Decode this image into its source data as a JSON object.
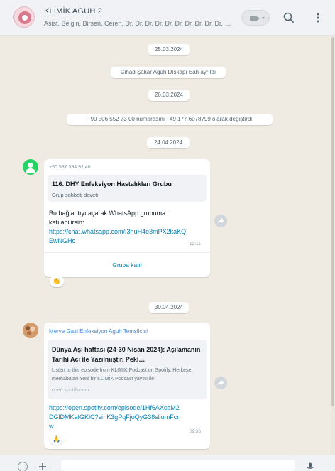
{
  "header": {
    "title": "KLİMİK AGUH 2",
    "members": "Asist. Belgin, Birsen, Ceren, Dr. Dr. Dr. Dr. Dr. Dr. Dr. Dr. Dr. Dr. Dr. ..."
  },
  "icons": {
    "video_call": "video-camera-icon",
    "search": "search-icon",
    "menu": "kebab-menu-icon",
    "forward": "forward-icon",
    "emoji": "smiley-icon",
    "attach": "plus-icon",
    "mic": "microphone-icon"
  },
  "colors": {
    "chat_background": "#efeae2",
    "bubble": "#ffffff",
    "link": "#027eb5",
    "sender_name": "#3a8ee6",
    "sender_avatar_green": "#25d366"
  },
  "dates": {
    "d1": "25.03.2024",
    "d2": "26.03.2024",
    "d3": "24.04.2024",
    "d4": "30.04.2024"
  },
  "system_messages": {
    "s1": "Cihad Şakar Aguh Dışkapı Eah ayrıldı",
    "s2": "+90 506 552 73 00 numarasını +49 177 6078799 olarak değiştirdi"
  },
  "message1": {
    "sender": "+90 537 594 92 46",
    "preview_title": "116. DHY Enfeksiyon Hastalıkları Grubu",
    "preview_subtitle": "Grup sohbeti daveti",
    "text": "Bu bağlantıyı açarak WhatsApp grubuma katılabilirsin:",
    "link": "https://chat.whatsapp.com/I3huH4e3mPX2kaKQEwNGHc",
    "time": "12:11",
    "join_label": "Gruba katıl",
    "reaction": "👏"
  },
  "message2": {
    "sender": "Merve Gazi Enfeksiyon Aguh Temsilcisi",
    "preview_title": "Dünya Aşı haftası (24-30 Nisan 2024): Aşılamanın Tarihi Acı ile Yazılmıştır. Peki…",
    "preview_desc": "Listen to this episode from KLIMIK Podcast on Spotify. Herkese merhabalar! Yeni bir KLİMİK Podcast yayını ile",
    "preview_domain": "open.spotify.com",
    "link": "https://open.spotify.com/episode/1Hf6AXcaM2DGlDMKafGKlC?si=K3gPqFjoQyG38sliumFcrw",
    "time": "09:36",
    "reaction": "🙏"
  }
}
